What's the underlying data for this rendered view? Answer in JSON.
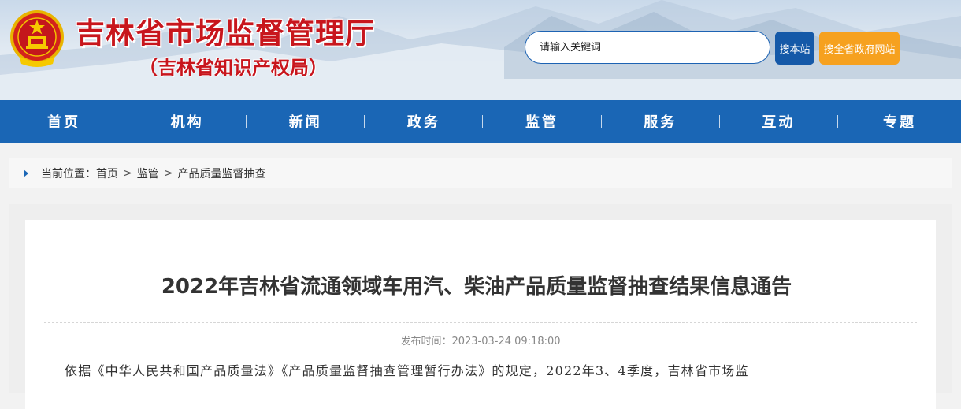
{
  "header": {
    "site_title": "吉林省市场监督管理厅",
    "site_subtitle": "（吉林省知识产权局）",
    "search": {
      "placeholder": "请输入关键词",
      "site_button": "搜本站",
      "gov_button": "搜全省政府网站"
    },
    "colors": {
      "title_red": "#c8161d",
      "nav_blue": "#1a66b5",
      "orange": "#f6a11f"
    }
  },
  "nav": {
    "items": [
      {
        "label": "首页"
      },
      {
        "label": "机构"
      },
      {
        "label": "新闻"
      },
      {
        "label": "政务"
      },
      {
        "label": "监管"
      },
      {
        "label": "服务"
      },
      {
        "label": "互动"
      },
      {
        "label": "专题"
      }
    ]
  },
  "breadcrumb": {
    "prefix": "当前位置：",
    "items": [
      "首页",
      "监管",
      "产品质量监督抽查"
    ],
    "separator": ">"
  },
  "article": {
    "title": "2022年吉林省流通领域车用汽、柴油产品质量监督抽查结果信息通告",
    "publish_time": "发布时间：2023-03-24 09:18:00",
    "body_first_line": "依据《中华人民共和国产品质量法》《产品质量监督抽查管理暂行办法》的规定，2022年3、4季度，吉林省市场监"
  }
}
